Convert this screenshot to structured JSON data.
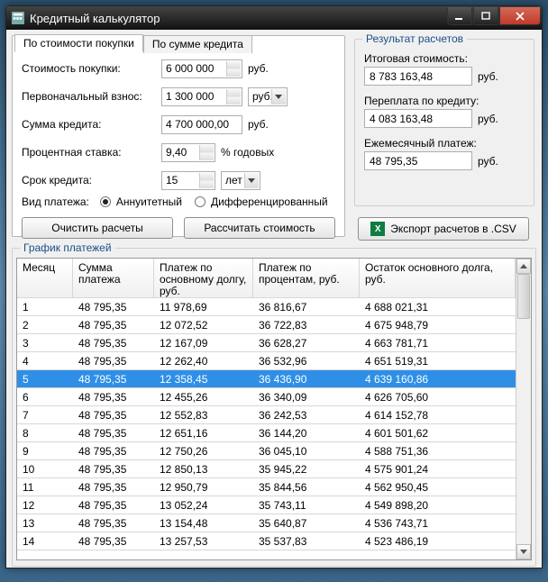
{
  "window": {
    "title": "Кредитный калькулятор"
  },
  "tabs": {
    "byPrice": "По стоимости покупки",
    "byLoan": "По сумме кредита"
  },
  "form": {
    "price_lbl": "Стоимость покупки:",
    "price_val": "6 000 000",
    "price_unit": "руб.",
    "down_lbl": "Первоначальный взнос:",
    "down_val": "1 300 000",
    "down_unit": "руб.",
    "loan_lbl": "Сумма кредита:",
    "loan_val": "4 700 000,00",
    "loan_unit": "руб.",
    "rate_lbl": "Процентная ставка:",
    "rate_val": "9,40",
    "rate_unit": "% годовых",
    "term_lbl": "Срок кредита:",
    "term_val": "15",
    "term_unit": "лет",
    "ptype_lbl": "Вид платежа:",
    "ptype_ann": "Аннуитетный",
    "ptype_diff": "Дифференцированный",
    "clear_btn": "Очистить расчеты",
    "calc_btn": "Рассчитать стоимость"
  },
  "results": {
    "title": "Результат расчетов",
    "total_lbl": "Итоговая стоимость:",
    "total_val": "8 783 163,48",
    "total_unit": "руб.",
    "over_lbl": "Переплата по кредиту:",
    "over_val": "4 083 163,48",
    "over_unit": "руб.",
    "monthly_lbl": "Ежемесячный платеж:",
    "monthly_val": "48 795,35",
    "monthly_unit": "руб.",
    "export_btn": "Экспорт расчетов в .CSV"
  },
  "schedule": {
    "title": "График платежей",
    "cols": {
      "c0": "Месяц",
      "c1": "Сумма платежа",
      "c2": "Платеж по основному долгу, руб.",
      "c3": "Платеж по процентам, руб.",
      "c4": "Остаток основного долга, руб."
    },
    "rows": [
      {
        "m": "1",
        "p": "48 795,35",
        "b": "11 978,69",
        "i": "36 816,67",
        "r": "4 688 021,31"
      },
      {
        "m": "2",
        "p": "48 795,35",
        "b": "12 072,52",
        "i": "36 722,83",
        "r": "4 675 948,79"
      },
      {
        "m": "3",
        "p": "48 795,35",
        "b": "12 167,09",
        "i": "36 628,27",
        "r": "4 663 781,71"
      },
      {
        "m": "4",
        "p": "48 795,35",
        "b": "12 262,40",
        "i": "36 532,96",
        "r": "4 651 519,31"
      },
      {
        "m": "5",
        "p": "48 795,35",
        "b": "12 358,45",
        "i": "36 436,90",
        "r": "4 639 160,86"
      },
      {
        "m": "6",
        "p": "48 795,35",
        "b": "12 455,26",
        "i": "36 340,09",
        "r": "4 626 705,60"
      },
      {
        "m": "7",
        "p": "48 795,35",
        "b": "12 552,83",
        "i": "36 242,53",
        "r": "4 614 152,78"
      },
      {
        "m": "8",
        "p": "48 795,35",
        "b": "12 651,16",
        "i": "36 144,20",
        "r": "4 601 501,62"
      },
      {
        "m": "9",
        "p": "48 795,35",
        "b": "12 750,26",
        "i": "36 045,10",
        "r": "4 588 751,36"
      },
      {
        "m": "10",
        "p": "48 795,35",
        "b": "12 850,13",
        "i": "35 945,22",
        "r": "4 575 901,24"
      },
      {
        "m": "11",
        "p": "48 795,35",
        "b": "12 950,79",
        "i": "35 844,56",
        "r": "4 562 950,45"
      },
      {
        "m": "12",
        "p": "48 795,35",
        "b": "13 052,24",
        "i": "35 743,11",
        "r": "4 549 898,20"
      },
      {
        "m": "13",
        "p": "48 795,35",
        "b": "13 154,48",
        "i": "35 640,87",
        "r": "4 536 743,71"
      },
      {
        "m": "14",
        "p": "48 795,35",
        "b": "13 257,53",
        "i": "35 537,83",
        "r": "4 523 486,19"
      }
    ],
    "selected": 4
  }
}
